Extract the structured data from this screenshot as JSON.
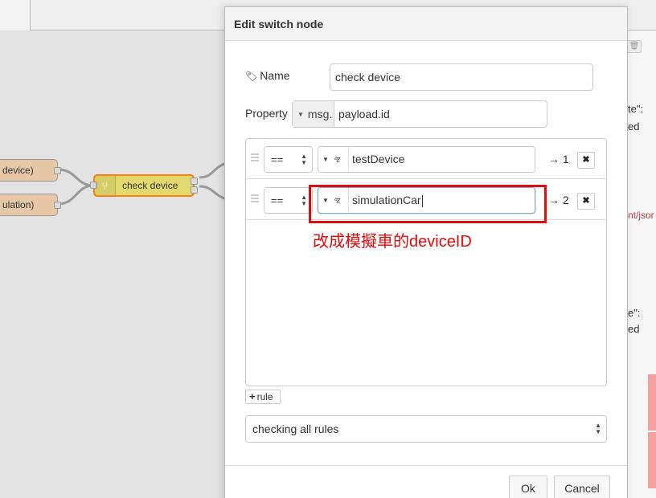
{
  "workspace": {
    "nodes": {
      "input1_label": "device)",
      "input2_label": "ulation)",
      "switch_label": "check device"
    }
  },
  "sidepanel": {
    "line1": "te\":",
    "line2": "ed",
    "line3": "nt/jsor",
    "line4": "e\":",
    "line5": "ed"
  },
  "dialog": {
    "title": "Edit switch node",
    "name_label": "Name",
    "name_value": "check device",
    "property_label": "Property",
    "property_type": "msg.",
    "property_value": "payload.id",
    "rules": [
      {
        "operator": "==",
        "value_type": "az",
        "value": "testDevice",
        "output": "→ 1",
        "delete": "✖"
      },
      {
        "operator": "==",
        "value_type": "az",
        "value": "simulationCar",
        "output": "→ 2",
        "delete": "✖"
      }
    ],
    "annotation": "改成模擬車的deviceID",
    "add_rule_label": "rule",
    "check_mode": "checking all rules",
    "ok_label": "Ok",
    "cancel_label": "Cancel"
  },
  "colors": {
    "annotation": "#e10c0c",
    "switch_node": "#e2d96e",
    "input_node": "#e6c7a6",
    "selected_border": "#ff7f0e"
  }
}
